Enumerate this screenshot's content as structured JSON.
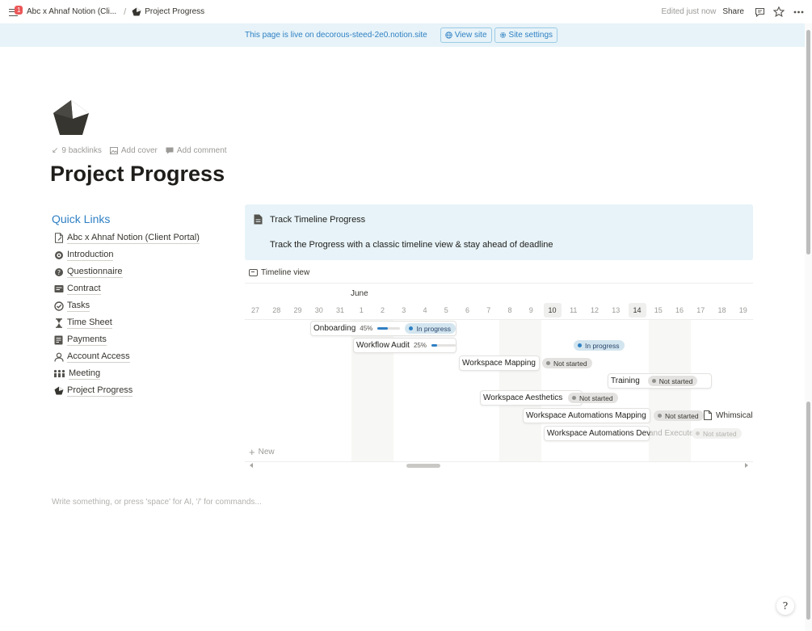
{
  "topbar": {
    "notification_count": "1",
    "breadcrumbs": [
      {
        "label": "Abc x Ahnaf Notion (Cli..."
      },
      {
        "label": "Project Progress"
      }
    ],
    "edited": "Edited just now",
    "share": "Share",
    "icons": [
      "comments-icon",
      "star-icon",
      "more-icon"
    ]
  },
  "banner": {
    "text": "This page is live on decorous-steed-2e0.notion.site",
    "view_site": "View site",
    "site_settings": "Site settings"
  },
  "page": {
    "icon": "pentagon-icon",
    "backlinks": "9 backlinks",
    "add_cover": "Add cover",
    "add_comment": "Add comment",
    "title": "Project Progress"
  },
  "quick_links": {
    "title": "Quick Links",
    "items": [
      {
        "label": "Abc x Ahnaf Notion (Client Portal)",
        "icon": "document-icon"
      },
      {
        "label": "Introduction",
        "icon": "target-icon"
      },
      {
        "label": "Questionnaire",
        "icon": "question-icon"
      },
      {
        "label": "Contract",
        "icon": "contract-icon"
      },
      {
        "label": "Tasks",
        "icon": "tasks-icon"
      },
      {
        "label": "Time Sheet",
        "icon": "hourglass-icon"
      },
      {
        "label": "Payments",
        "icon": "payments-icon"
      },
      {
        "label": "Account Access",
        "icon": "account-icon"
      },
      {
        "label": "Meeting",
        "icon": "meeting-icon"
      },
      {
        "label": "Project Progress",
        "icon": "pentagon-icon"
      }
    ]
  },
  "callout": {
    "title": "Track Timeline Progress",
    "text": "Track the Progress with a classic timeline view & stay ahead of deadline"
  },
  "timeline": {
    "view_label": "Timeline view",
    "month": "June",
    "days": [
      "27",
      "28",
      "29",
      "30",
      "31",
      "1",
      "2",
      "3",
      "4",
      "5",
      "6",
      "7",
      "8",
      "9",
      "10",
      "11",
      "12",
      "13",
      "14",
      "15",
      "16",
      "17",
      "18",
      "19"
    ],
    "highlighted_days": [
      "10",
      "14"
    ],
    "tasks": [
      {
        "name": "Onboarding",
        "percent": "45%",
        "progress": 0.45,
        "status": "In progress"
      },
      {
        "name": "Workflow Audit",
        "percent": "25%",
        "progress": 0.25,
        "status": "In progress"
      },
      {
        "name": "Workspace Mapping",
        "status": "Not started"
      },
      {
        "name": "Training",
        "status": "Not started"
      },
      {
        "name": "Workspace Aesthetics",
        "status": "Not started"
      },
      {
        "name": "Workspace Automations Mapping",
        "status": "Not started",
        "extra": "Whimsical"
      },
      {
        "name": "Workspace Automations Dev",
        "overflow": "and Execute",
        "status": "Not started"
      }
    ],
    "new_label": "New"
  },
  "editor": {
    "placeholder": "Write something, or press 'space' for AI, '/' for commands..."
  },
  "help": {
    "label": "?"
  }
}
